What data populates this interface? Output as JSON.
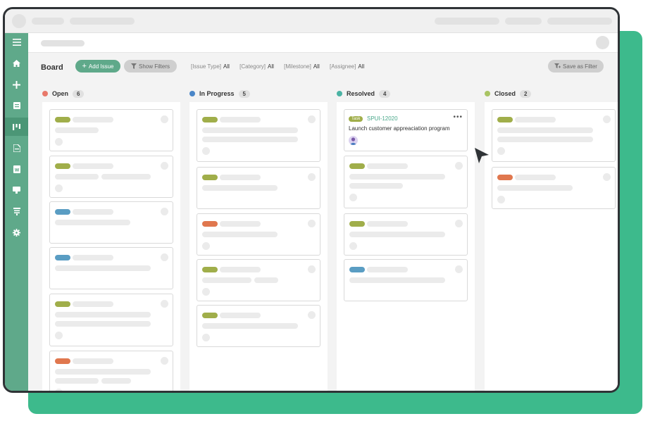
{
  "toolbar": {
    "title": "Board",
    "add_issue": "Add Issue",
    "show_filters": "Show Filters",
    "save_as_filter": "Save as Filter",
    "filters": [
      {
        "label": "[Issue Type]",
        "value": "All"
      },
      {
        "label": "[Category]",
        "value": "All"
      },
      {
        "label": "[Milestone]",
        "value": "All"
      },
      {
        "label": "[Assignee]",
        "value": "All"
      }
    ]
  },
  "sidebar": {
    "items": [
      "menu-icon",
      "home-icon",
      "add-icon",
      "list-icon",
      "board-icon",
      "document-icon",
      "wiki-icon",
      "files-icon",
      "gantt-icon",
      "settings-icon"
    ],
    "active": "board-icon"
  },
  "columns": [
    {
      "name": "Open",
      "count": "6",
      "color": "#e8786a"
    },
    {
      "name": "In Progress",
      "count": "5",
      "color": "#4a86c8"
    },
    {
      "name": "Resolved",
      "count": "4",
      "color": "#4bb3a4"
    },
    {
      "name": "Closed",
      "count": "2",
      "color": "#a9c463"
    }
  ],
  "featured_card": {
    "type": "Task",
    "key": "SPUI-12020",
    "summary": "Launch customer appreaciation program"
  },
  "colors": {
    "accent": "#5fa98a",
    "backdrop": "#3dba8c",
    "tag_green": "#a0ae4a",
    "tag_blue": "#5a9dc3",
    "tag_orange": "#e0774e"
  }
}
